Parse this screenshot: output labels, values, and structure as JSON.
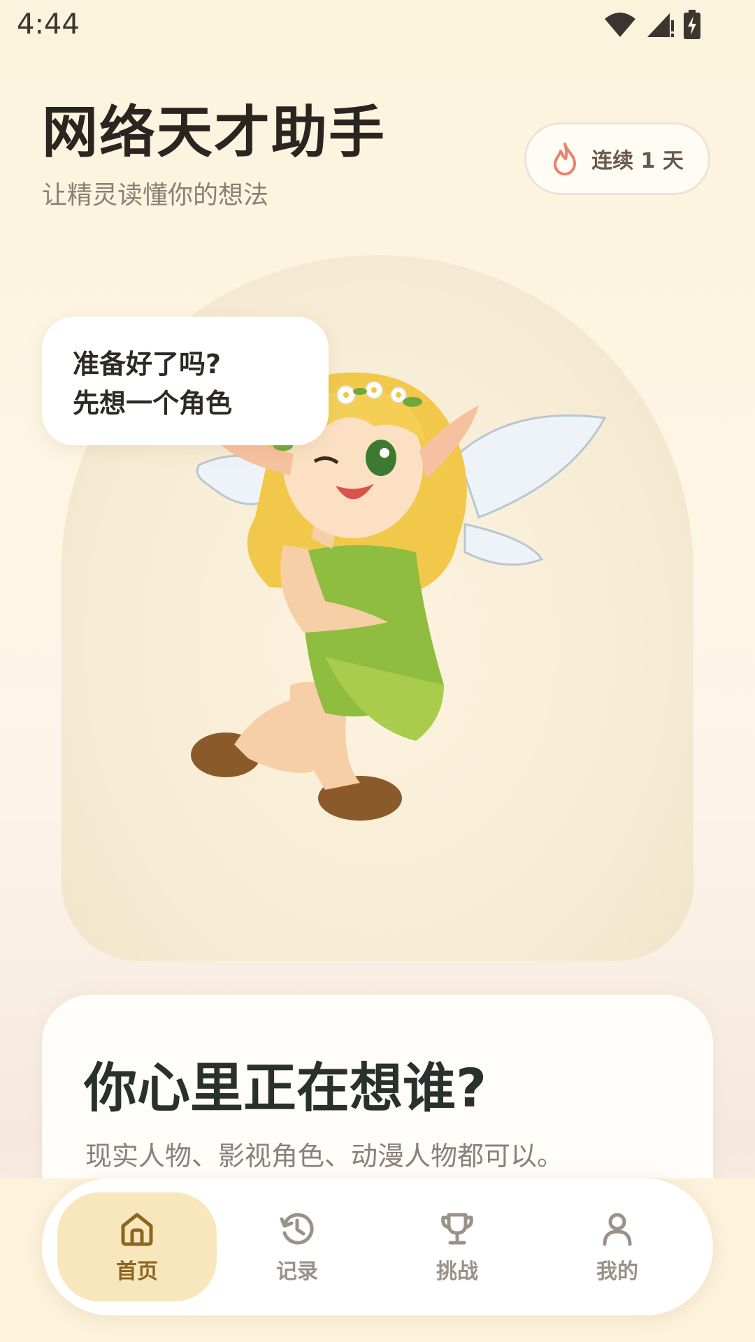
{
  "status_bar": {
    "time": "4:44"
  },
  "header": {
    "title": "网络天才助手",
    "subtitle": "让精灵读懂你的想法",
    "streak_label": "连续 1 天"
  },
  "hero": {
    "speech_lines": [
      "准备好了吗?",
      "先想一个角色"
    ]
  },
  "question_card": {
    "title": "你心里正在想谁?",
    "description": "现实人物、影视角色、动漫人物都可以。"
  },
  "bottom_nav": {
    "items": [
      {
        "label": "首页",
        "icon": "home-icon",
        "active": true
      },
      {
        "label": "记录",
        "icon": "history-icon",
        "active": false
      },
      {
        "label": "挑战",
        "icon": "trophy-icon",
        "active": false
      },
      {
        "label": "我的",
        "icon": "profile-icon",
        "active": false
      }
    ]
  },
  "colors": {
    "accent": "#f8e7bd",
    "accent_text": "#8c6520",
    "flame": "#e8846c",
    "title": "#2b2521"
  }
}
